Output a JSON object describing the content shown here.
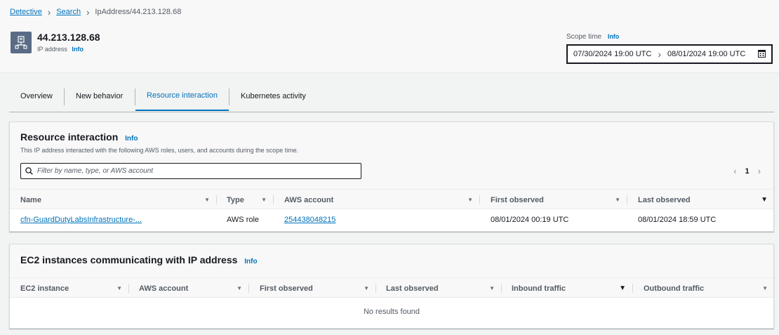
{
  "breadcrumb": {
    "items": [
      "Detective",
      "Search"
    ],
    "current": "IpAddress/44.213.128.68"
  },
  "entity": {
    "title": "44.213.128.68",
    "subtitle": "IP address",
    "info": "Info",
    "icon": "ip-address-icon"
  },
  "scope": {
    "label": "Scope time",
    "info": "Info",
    "start": "07/30/2024 19:00 UTC",
    "end": "08/01/2024 19:00 UTC"
  },
  "tabs": [
    {
      "label": "Overview"
    },
    {
      "label": "New behavior"
    },
    {
      "label": "Resource interaction"
    },
    {
      "label": "Kubernetes activity"
    }
  ],
  "resource_panel": {
    "title": "Resource interaction",
    "info": "Info",
    "description": "This IP address interacted with the following AWS roles, users, and accounts during the scope time.",
    "filter_placeholder": "Filter by name, type, or AWS account",
    "page": "1",
    "columns": [
      "Name",
      "Type",
      "AWS account",
      "First observed",
      "Last observed"
    ],
    "rows": [
      {
        "name": "cfn-GuardDutyLabsInfrastructure-...",
        "type": "AWS role",
        "account": "254438048215",
        "first_observed": "08/01/2024 00:19 UTC",
        "last_observed": "08/01/2024 18:59 UTC"
      }
    ]
  },
  "ec2_panel": {
    "title": "EC2 instances communicating with IP address",
    "info": "Info",
    "columns": [
      "EC2 instance",
      "AWS account",
      "First observed",
      "Last observed",
      "Inbound traffic",
      "Outbound traffic"
    ],
    "empty": "No results found"
  },
  "colors": {
    "link": "#0073bb",
    "icon_bg": "#5a6b86",
    "text": "#16191f",
    "muted": "#545b64"
  }
}
